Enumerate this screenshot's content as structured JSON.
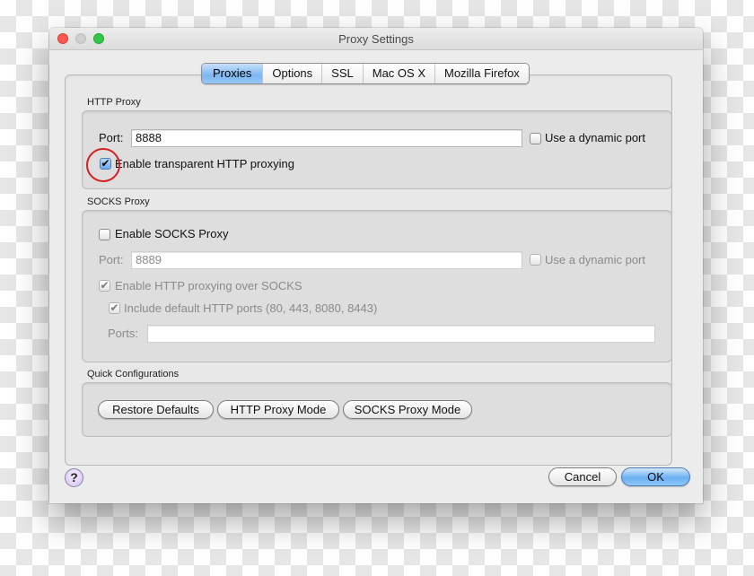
{
  "window": {
    "title": "Proxy Settings"
  },
  "tabs": [
    {
      "label": "Proxies",
      "active": true
    },
    {
      "label": "Options",
      "active": false
    },
    {
      "label": "SSL",
      "active": false
    },
    {
      "label": "Mac OS X",
      "active": false
    },
    {
      "label": "Mozilla Firefox",
      "active": false
    }
  ],
  "http_proxy": {
    "section_label": "HTTP Proxy",
    "port_label": "Port:",
    "port_value": "8888",
    "dynamic_port_label": "Use a dynamic port",
    "dynamic_port_checked": false,
    "transparent_label": "Enable transparent HTTP proxying",
    "transparent_checked": true
  },
  "socks_proxy": {
    "section_label": "SOCKS Proxy",
    "enable_label": "Enable SOCKS Proxy",
    "enable_checked": false,
    "port_label": "Port:",
    "port_value": "8889",
    "dynamic_port_label": "Use a dynamic port",
    "dynamic_port_checked": false,
    "http_over_socks_label": "Enable HTTP proxying over SOCKS",
    "http_over_socks_checked": true,
    "include_default_ports_label": "Include default HTTP ports (80, 443, 8080, 8443)",
    "include_default_ports_checked": true,
    "ports_label": "Ports:",
    "ports_value": ""
  },
  "quick_config": {
    "section_label": "Quick Configurations",
    "restore_defaults": "Restore Defaults",
    "http_proxy_mode": "HTTP Proxy Mode",
    "socks_proxy_mode": "SOCKS Proxy Mode"
  },
  "footer": {
    "help_symbol": "?",
    "cancel": "Cancel",
    "ok": "OK"
  },
  "check_glyph": "✔"
}
